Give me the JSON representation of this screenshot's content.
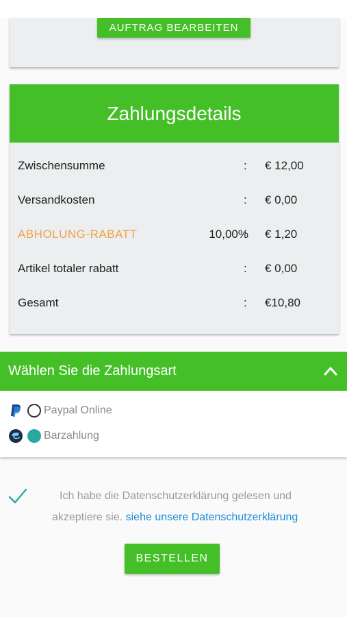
{
  "order_card": {
    "edit_button": "AUFTRAG BEARBEITEN"
  },
  "payment_details": {
    "title": "Zahlungsdetails",
    "rows": [
      {
        "label": "Zwischensumme",
        "percent": "",
        "colon": ":",
        "amount": "€ 12,00"
      },
      {
        "label": "Versandkosten",
        "percent": "",
        "colon": ":",
        "amount": "€ 0,00"
      },
      {
        "label": "ABHOLUNG-RABATT",
        "percent": "10,00%",
        "colon": ":",
        "amount": "€ 1,20"
      },
      {
        "label": "Artikel totaler rabatt",
        "percent": "",
        "colon": ":",
        "amount": "€ 0,00"
      },
      {
        "label": "Gesamt",
        "percent": "",
        "colon": ":",
        "amount": "€10,80"
      }
    ]
  },
  "payment_method": {
    "title": "Wählen Sie die Zahlungsart",
    "options": [
      {
        "label": "Paypal Online",
        "icon": "paypal-icon",
        "selected": false
      },
      {
        "label": "Barzahlung",
        "icon": "cash-icon",
        "selected": true
      }
    ]
  },
  "consent": {
    "line1": "Ich habe die Datenschutzerklärung gelesen und",
    "line2_text": "akzeptiere sie.",
    "line2_link": "siehe unsere Datenschutzerklärung"
  },
  "order_button": "BESTELLEN",
  "colors": {
    "accent": "#45bf27",
    "discount": "#f0a24a",
    "link": "#1e8ed8",
    "radio_selected": "#2aa9a0"
  }
}
